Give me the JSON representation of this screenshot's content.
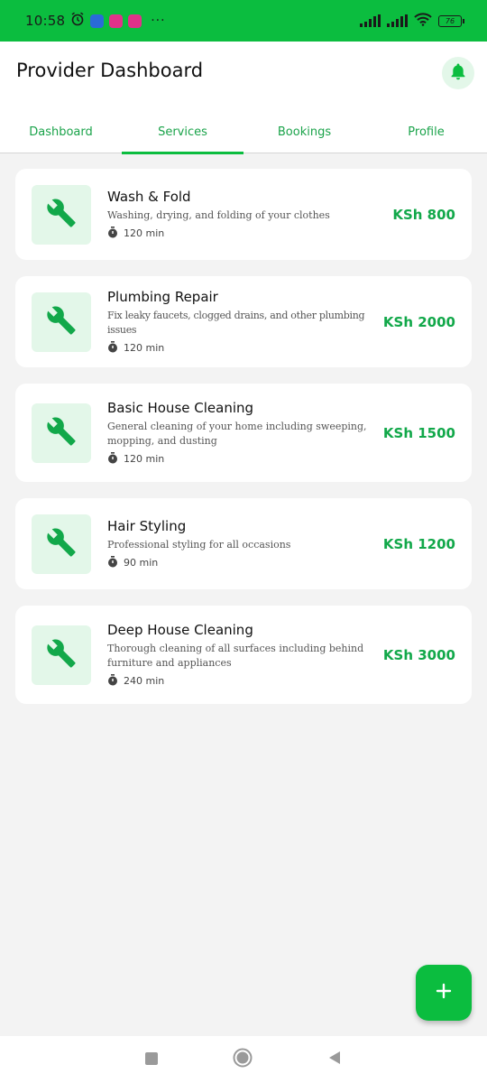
{
  "status_bar": {
    "time": "10:58",
    "dots": "···",
    "battery": "76"
  },
  "header": {
    "title": "Provider Dashboard",
    "bell_icon": "notification-bell-icon"
  },
  "tabs": [
    {
      "label": "Dashboard",
      "active": false
    },
    {
      "label": "Services",
      "active": true
    },
    {
      "label": "Bookings",
      "active": false
    },
    {
      "label": "Profile",
      "active": false
    }
  ],
  "services": [
    {
      "name": "Wash & Fold",
      "description": "Washing, drying, and folding of your clothes",
      "duration": "120 min",
      "price": "KSh 800"
    },
    {
      "name": "Plumbing Repair",
      "description": "Fix leaky faucets, clogged drains, and other plumbing issues",
      "duration": "120 min",
      "price": "KSh 2000"
    },
    {
      "name": "Basic House Cleaning",
      "description": "General cleaning of your home including sweeping, mopping, and dusting",
      "duration": "120 min",
      "price": "KSh 1500"
    },
    {
      "name": "Hair Styling",
      "description": "Professional styling for all occasions",
      "duration": "90 min",
      "price": "KSh 1200"
    },
    {
      "name": "Deep House Cleaning",
      "description": "Thorough cleaning of all surfaces including behind furniture and appliances",
      "duration": "240 min",
      "price": "KSh 3000"
    }
  ],
  "colors": {
    "accent": "#0bbd3f",
    "price": "#12a84a",
    "icon_bg": "#e3f7e9"
  },
  "fab": {
    "icon": "plus-icon"
  },
  "nav": {
    "icons": [
      "square-recents-icon",
      "circle-home-icon",
      "triangle-back-icon"
    ]
  }
}
